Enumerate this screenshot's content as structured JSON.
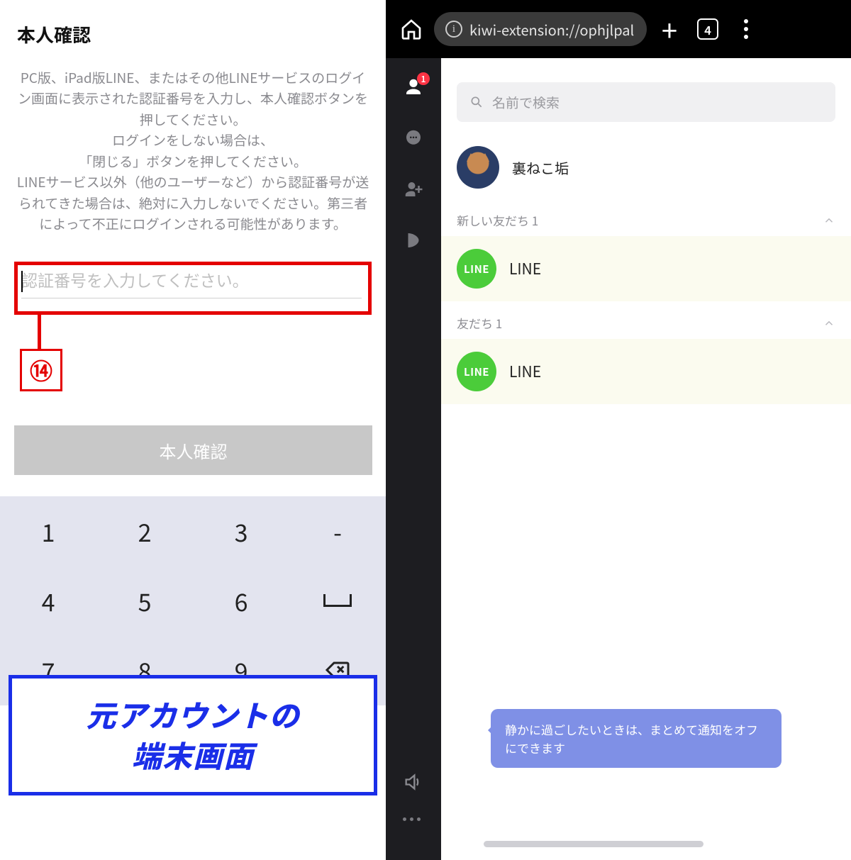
{
  "left": {
    "title": "本人確認",
    "description": "PC版、iPad版LINE、またはその他LINEサービスのログイン画面に表示された認証番号を入力し、本人確認ボタンを押してください。\nログインをしない場合は、\n「閉じる」ボタンを押してください。\nLINEサービス以外（他のユーザーなど）から認証番号が送られてきた場合は、絶対に入力しないでください。第三者によって不正にログインされる可能性があります。",
    "input_placeholder": "認証番号を入力してください。",
    "marker": "⑭",
    "confirm_label": "本人確認",
    "keypad": {
      "row1": [
        "1",
        "2",
        "3",
        "-"
      ],
      "row2": [
        "4",
        "5",
        "6"
      ],
      "row3": [
        "7",
        "8",
        "9"
      ]
    },
    "annotation": "元アカウントの\n端末画面"
  },
  "right": {
    "topbar": {
      "url": "kiwi-extension://ophjlpal",
      "tab_count": "4"
    },
    "sidebar": {
      "badge": "1"
    },
    "search_placeholder": "名前で検索",
    "profile_name": "裏ねこ垢",
    "section1": "新しい友だち 1",
    "friend1": "LINE",
    "section2": "友だち 1",
    "friend2": "LINE",
    "tooltip": "静かに過ごしたいときは、まとめて通知をオフにできます"
  }
}
